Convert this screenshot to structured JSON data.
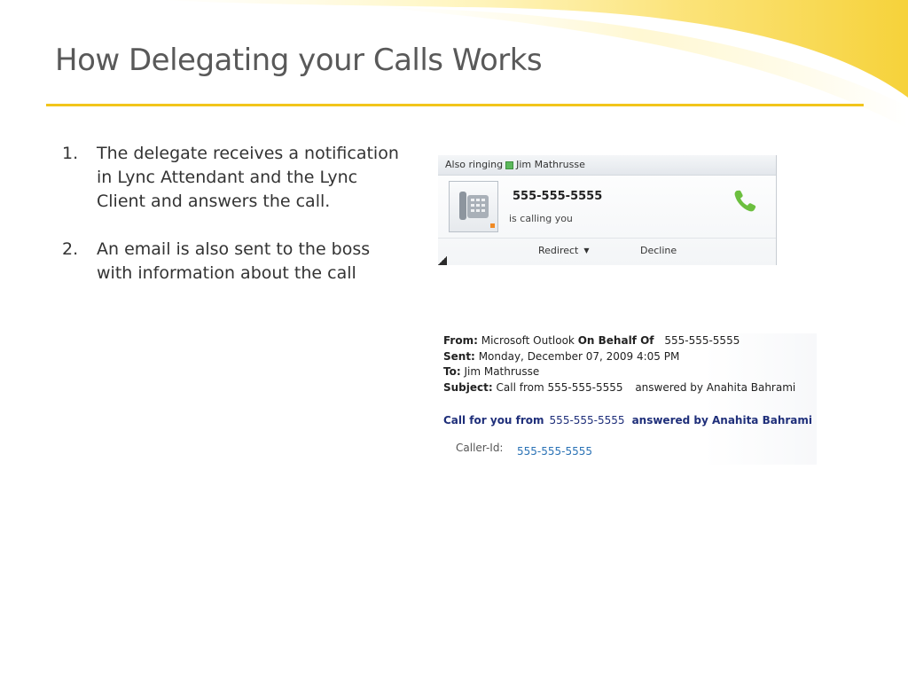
{
  "slide": {
    "title": "How Delegating your Calls Works",
    "bullets": [
      {
        "number": "1.",
        "text": "The delegate receives a notification in Lync Attendant and the Lync Client and answers the call."
      },
      {
        "number": "2.",
        "text": "An email is also sent to the boss with information about the call"
      }
    ]
  },
  "lync_notification": {
    "header_prefix": "Also ringing",
    "header_name": "Jim Mathrusse",
    "caller_number": "555-555-5555",
    "status_text": "is calling you",
    "redirect_label": "Redirect",
    "decline_label": "Decline",
    "icons": {
      "presence": "green-presence-square",
      "caller": "desk-phone-icon",
      "answer": "green-phone-handset-icon"
    }
  },
  "email": {
    "from_label": "From:",
    "from_value": "Microsoft Outlook",
    "on_behalf_label": "On Behalf Of",
    "on_behalf_value": "555-555-5555",
    "sent_label": "Sent:",
    "sent_value": "Monday, December 07, 2009 4:05 PM",
    "to_label": "To:",
    "to_value": "Jim Mathrusse",
    "subject_label": "Subject:",
    "subject_prefix": "Call from",
    "subject_number": "555-555-5555",
    "subject_suffix": "answered by Anahita Bahrami",
    "body_prefix": "Call for you from",
    "body_number": "555-555-5555",
    "body_suffix": "answered by Anahita Bahrami",
    "caller_id_label": "Caller-Id:",
    "caller_id_value": "555-555-5555"
  },
  "colors": {
    "accent_yellow": "#f2c51b",
    "title_gray": "#595959",
    "email_navy": "#1f2f7a",
    "link_blue": "#2a72b5",
    "answer_green": "#6cbf3f"
  }
}
